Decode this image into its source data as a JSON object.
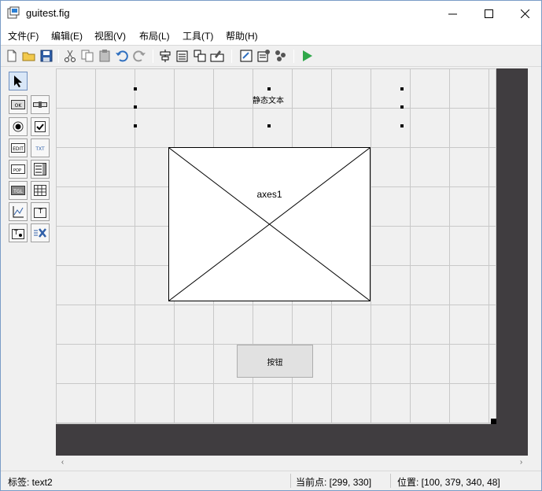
{
  "window": {
    "title": "guitest.fig",
    "controls": {
      "minimize": "—",
      "maximize": "☐",
      "close": "✕"
    }
  },
  "menubar": {
    "items": [
      {
        "label": "文件(F)"
      },
      {
        "label": "编辑(E)"
      },
      {
        "label": "视图(V)"
      },
      {
        "label": "布局(L)"
      },
      {
        "label": "工具(T)"
      },
      {
        "label": "帮助(H)"
      }
    ]
  },
  "toolbar": {
    "icons": [
      "new-file-icon",
      "open-folder-icon",
      "save-icon",
      "cut-icon",
      "copy-icon",
      "paste-icon",
      "undo-icon",
      "redo-icon",
      "align-icon",
      "menu-editor-icon",
      "tab-order-icon",
      "toolbar-editor-icon",
      "editor-icon",
      "property-inspector-icon",
      "object-browser-icon",
      "run-icon"
    ]
  },
  "palette": {
    "items": [
      {
        "name": "select-arrow-icon",
        "glyph": "➚"
      },
      {
        "name": "push-button-icon",
        "glyph": "OK"
      },
      {
        "name": "slider-icon",
        "glyph": "▭"
      },
      {
        "name": "radio-button-icon",
        "glyph": "◉"
      },
      {
        "name": "checkbox-icon",
        "glyph": "☑"
      },
      {
        "name": "edit-text-icon",
        "glyph": "EDIT"
      },
      {
        "name": "static-text-icon",
        "glyph": "TXT"
      },
      {
        "name": "popup-menu-icon",
        "glyph": "POP"
      },
      {
        "name": "listbox-icon",
        "glyph": "☰"
      },
      {
        "name": "toggle-button-icon",
        "glyph": "TGL"
      },
      {
        "name": "table-icon",
        "glyph": "▦"
      },
      {
        "name": "axes-icon",
        "glyph": "📈"
      },
      {
        "name": "panel-icon",
        "glyph": "T"
      },
      {
        "name": "button-group-icon",
        "glyph": "T"
      },
      {
        "name": "activex-icon",
        "glyph": "X"
      }
    ]
  },
  "canvas": {
    "static_text": "静态文本",
    "axes_label": "axes1",
    "button_label": "按钮"
  },
  "scrollbar": {
    "left_arrow": "‹",
    "right_arrow": "›"
  },
  "status": {
    "tag": "标签: text2",
    "current_point": "当前点:  [299, 330]",
    "position": "位置: [100, 379, 340, 48]"
  }
}
